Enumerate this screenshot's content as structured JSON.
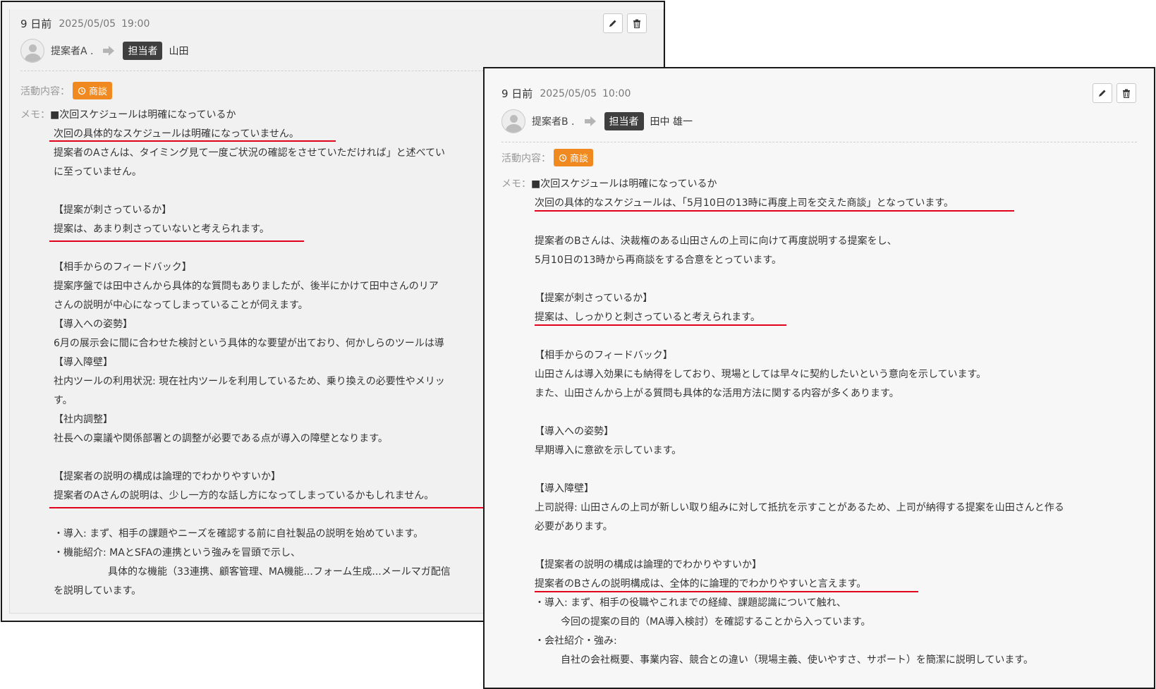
{
  "cards": [
    {
      "days_ago": "9 日前",
      "date": "2025/05/05",
      "time": "19:00",
      "proposer": "提案者A .",
      "assignee_badge": "担当者",
      "assignee": "山田",
      "activity_label": "活動内容：",
      "activity_badge": "商談",
      "memo_label": "メモ：",
      "memo_first": "■次回スケジュールは明確になっているか",
      "lines": [
        "次回の具体的なスケジュールは明確になっていません。",
        "提案者のAさんは、タイミング見て一度ご状況の確認をさせていただければ」と述べてい",
        "に至っていません。",
        "【提案が刺さっているか】",
        "提案は、あまり刺さっていないと考えられます。",
        "【相手からのフィードバック】",
        "提案序盤では田中さんから具体的な質問もありましたが、後半にかけて田中さんのリア",
        "さんの説明が中心になってしまっていることが伺えます。",
        "【導入への姿勢】",
        "6月の展示会に間に合わせた検討という具体的な要望が出ており、何かしらのツールは導",
        "【導入障壁】",
        "社内ツールの利用状況: 現在社内ツールを利用しているため、乗り換えの必要性やメリッ",
        "す。",
        "【社内調整】",
        "社長への稟議や関係部署との調整が必要である点が導入の障壁となります。",
        "【提案者の説明の構成は論理的でわかりやすいか】",
        "提案者のAさんの説明は、少し一方的な話し方になってしまっているかもしれません。",
        "・導入: まず、相手の課題やニーズを確認する前に自社製品の説明を始めています。",
        "・機能紹介: MAとSFAの連携という強みを冒頭で示し、",
        "具体的な機能（33連携、顧客管理、MA機能...フォーム生成...メールマガ配信",
        "を説明しています。"
      ]
    },
    {
      "days_ago": "9 日前",
      "date": "2025/05/05",
      "time": "10:00",
      "proposer": "提案者B .",
      "assignee_badge": "担当者",
      "assignee": "田中 雄一",
      "activity_label": "活動内容：",
      "activity_badge": "商談",
      "memo_label": "メモ：",
      "memo_first": "■次回スケジュールは明確になっているか",
      "lines": [
        "次回の具体的なスケジュールは、「5月10日の13時に再度上司を交えた商談」となっています。",
        "提案者のBさんは、決裁権のある山田さんの上司に向けて再度説明する提案をし、",
        "5月10日の13時から再商談をする合意をとっています。",
        "【提案が刺さっているか】",
        "提案は、しっかりと刺さっていると考えられます。",
        "【相手からのフィードバック】",
        "山田さんは導入効果にも納得をしており、現場としては早々に契約したいという意向を示しています。",
        "また、山田さんから上がる質問も具体的な活用方法に関する内容が多くあります。",
        "【導入への姿勢】",
        "早期導入に意欲を示しています。",
        "【導入障壁】",
        "上司説得: 山田さんの上司が新しい取り組みに対して抵抗を示すことがあるため、上司が納得する提案を山田さんと作る",
        "必要があります。",
        "【提案者の説明の構成は論理的でわかりやすいか】",
        "提案者のBさんの説明構成は、全体的に論理的でわかりやすいと言えます。",
        "・導入: まず、相手の役職やこれまでの経緯、課題認識について触れ、",
        "今回の提案の目的（MA導入検討）を確認することから入っています。",
        "・会社紹介・強み:",
        "自社の会社概要、事業内容、競合との違い（現場主義、使いやすさ、サポート）を簡潔に説明しています。"
      ]
    }
  ],
  "colors": {
    "accent_orange": "#f08a20",
    "underline_red": "#e0001b",
    "badge_dark": "#3f3f3f"
  }
}
